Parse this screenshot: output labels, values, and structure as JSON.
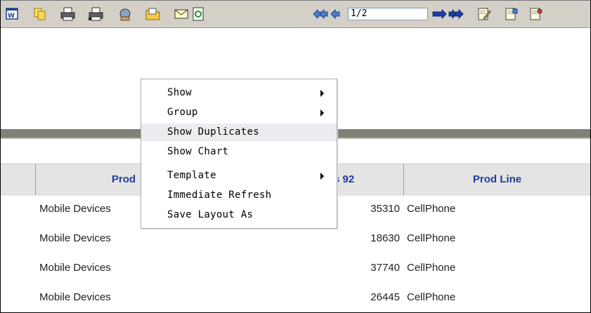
{
  "toolbar": {
    "buttons": [
      {
        "name": "word-export-icon"
      },
      {
        "name": "copy-icon"
      },
      {
        "name": "print-icon"
      },
      {
        "name": "print-preview-icon"
      },
      {
        "name": "send-icon"
      },
      {
        "name": "open-folder-icon"
      },
      {
        "name": "email-icon"
      },
      {
        "name": "refresh-icon"
      }
    ],
    "page_value": "1/2"
  },
  "context_menu": {
    "items": [
      {
        "label": "Show",
        "submenu": true
      },
      {
        "label": "Group",
        "submenu": true
      },
      {
        "label": "Show Duplicates",
        "submenu": false
      },
      {
        "label": "Show Chart",
        "submenu": false
      },
      {
        "label": "Template",
        "submenu": true
      },
      {
        "label": "Immediate Refresh",
        "submenu": false
      },
      {
        "label": "Save Layout As",
        "submenu": false
      }
    ]
  },
  "grid": {
    "headers": [
      "Prod",
      "s 92",
      "Prod Line"
    ],
    "rows": [
      {
        "product": "Mobile Devices",
        "value": "35310",
        "line": "CellPhone"
      },
      {
        "product": "Mobile Devices",
        "value": "18630",
        "line": "CellPhone"
      },
      {
        "product": "Mobile Devices",
        "value": "37740",
        "line": "CellPhone"
      },
      {
        "product": "Mobile Devices",
        "value": "26445",
        "line": "CellPhone"
      }
    ]
  }
}
